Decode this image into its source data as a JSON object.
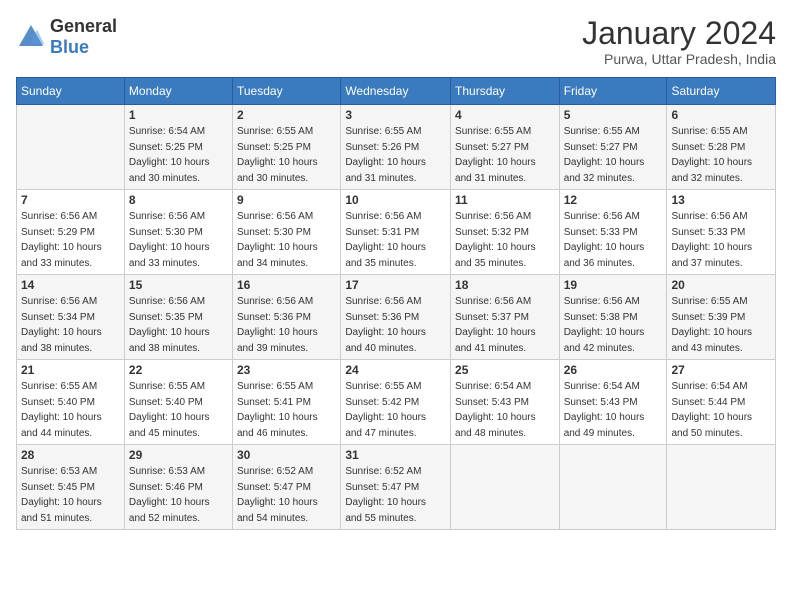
{
  "header": {
    "logo_general": "General",
    "logo_blue": "Blue",
    "month_year": "January 2024",
    "location": "Purwa, Uttar Pradesh, India"
  },
  "weekdays": [
    "Sunday",
    "Monday",
    "Tuesday",
    "Wednesday",
    "Thursday",
    "Friday",
    "Saturday"
  ],
  "weeks": [
    [
      {
        "day": "",
        "sunrise": "",
        "sunset": "",
        "daylight": ""
      },
      {
        "day": "1",
        "sunrise": "Sunrise: 6:54 AM",
        "sunset": "Sunset: 5:25 PM",
        "daylight": "Daylight: 10 hours and 30 minutes."
      },
      {
        "day": "2",
        "sunrise": "Sunrise: 6:55 AM",
        "sunset": "Sunset: 5:25 PM",
        "daylight": "Daylight: 10 hours and 30 minutes."
      },
      {
        "day": "3",
        "sunrise": "Sunrise: 6:55 AM",
        "sunset": "Sunset: 5:26 PM",
        "daylight": "Daylight: 10 hours and 31 minutes."
      },
      {
        "day": "4",
        "sunrise": "Sunrise: 6:55 AM",
        "sunset": "Sunset: 5:27 PM",
        "daylight": "Daylight: 10 hours and 31 minutes."
      },
      {
        "day": "5",
        "sunrise": "Sunrise: 6:55 AM",
        "sunset": "Sunset: 5:27 PM",
        "daylight": "Daylight: 10 hours and 32 minutes."
      },
      {
        "day": "6",
        "sunrise": "Sunrise: 6:55 AM",
        "sunset": "Sunset: 5:28 PM",
        "daylight": "Daylight: 10 hours and 32 minutes."
      }
    ],
    [
      {
        "day": "7",
        "sunrise": "Sunrise: 6:56 AM",
        "sunset": "Sunset: 5:29 PM",
        "daylight": "Daylight: 10 hours and 33 minutes."
      },
      {
        "day": "8",
        "sunrise": "Sunrise: 6:56 AM",
        "sunset": "Sunset: 5:30 PM",
        "daylight": "Daylight: 10 hours and 33 minutes."
      },
      {
        "day": "9",
        "sunrise": "Sunrise: 6:56 AM",
        "sunset": "Sunset: 5:30 PM",
        "daylight": "Daylight: 10 hours and 34 minutes."
      },
      {
        "day": "10",
        "sunrise": "Sunrise: 6:56 AM",
        "sunset": "Sunset: 5:31 PM",
        "daylight": "Daylight: 10 hours and 35 minutes."
      },
      {
        "day": "11",
        "sunrise": "Sunrise: 6:56 AM",
        "sunset": "Sunset: 5:32 PM",
        "daylight": "Daylight: 10 hours and 35 minutes."
      },
      {
        "day": "12",
        "sunrise": "Sunrise: 6:56 AM",
        "sunset": "Sunset: 5:33 PM",
        "daylight": "Daylight: 10 hours and 36 minutes."
      },
      {
        "day": "13",
        "sunrise": "Sunrise: 6:56 AM",
        "sunset": "Sunset: 5:33 PM",
        "daylight": "Daylight: 10 hours and 37 minutes."
      }
    ],
    [
      {
        "day": "14",
        "sunrise": "Sunrise: 6:56 AM",
        "sunset": "Sunset: 5:34 PM",
        "daylight": "Daylight: 10 hours and 38 minutes."
      },
      {
        "day": "15",
        "sunrise": "Sunrise: 6:56 AM",
        "sunset": "Sunset: 5:35 PM",
        "daylight": "Daylight: 10 hours and 38 minutes."
      },
      {
        "day": "16",
        "sunrise": "Sunrise: 6:56 AM",
        "sunset": "Sunset: 5:36 PM",
        "daylight": "Daylight: 10 hours and 39 minutes."
      },
      {
        "day": "17",
        "sunrise": "Sunrise: 6:56 AM",
        "sunset": "Sunset: 5:36 PM",
        "daylight": "Daylight: 10 hours and 40 minutes."
      },
      {
        "day": "18",
        "sunrise": "Sunrise: 6:56 AM",
        "sunset": "Sunset: 5:37 PM",
        "daylight": "Daylight: 10 hours and 41 minutes."
      },
      {
        "day": "19",
        "sunrise": "Sunrise: 6:56 AM",
        "sunset": "Sunset: 5:38 PM",
        "daylight": "Daylight: 10 hours and 42 minutes."
      },
      {
        "day": "20",
        "sunrise": "Sunrise: 6:55 AM",
        "sunset": "Sunset: 5:39 PM",
        "daylight": "Daylight: 10 hours and 43 minutes."
      }
    ],
    [
      {
        "day": "21",
        "sunrise": "Sunrise: 6:55 AM",
        "sunset": "Sunset: 5:40 PM",
        "daylight": "Daylight: 10 hours and 44 minutes."
      },
      {
        "day": "22",
        "sunrise": "Sunrise: 6:55 AM",
        "sunset": "Sunset: 5:40 PM",
        "daylight": "Daylight: 10 hours and 45 minutes."
      },
      {
        "day": "23",
        "sunrise": "Sunrise: 6:55 AM",
        "sunset": "Sunset: 5:41 PM",
        "daylight": "Daylight: 10 hours and 46 minutes."
      },
      {
        "day": "24",
        "sunrise": "Sunrise: 6:55 AM",
        "sunset": "Sunset: 5:42 PM",
        "daylight": "Daylight: 10 hours and 47 minutes."
      },
      {
        "day": "25",
        "sunrise": "Sunrise: 6:54 AM",
        "sunset": "Sunset: 5:43 PM",
        "daylight": "Daylight: 10 hours and 48 minutes."
      },
      {
        "day": "26",
        "sunrise": "Sunrise: 6:54 AM",
        "sunset": "Sunset: 5:43 PM",
        "daylight": "Daylight: 10 hours and 49 minutes."
      },
      {
        "day": "27",
        "sunrise": "Sunrise: 6:54 AM",
        "sunset": "Sunset: 5:44 PM",
        "daylight": "Daylight: 10 hours and 50 minutes."
      }
    ],
    [
      {
        "day": "28",
        "sunrise": "Sunrise: 6:53 AM",
        "sunset": "Sunset: 5:45 PM",
        "daylight": "Daylight: 10 hours and 51 minutes."
      },
      {
        "day": "29",
        "sunrise": "Sunrise: 6:53 AM",
        "sunset": "Sunset: 5:46 PM",
        "daylight": "Daylight: 10 hours and 52 minutes."
      },
      {
        "day": "30",
        "sunrise": "Sunrise: 6:52 AM",
        "sunset": "Sunset: 5:47 PM",
        "daylight": "Daylight: 10 hours and 54 minutes."
      },
      {
        "day": "31",
        "sunrise": "Sunrise: 6:52 AM",
        "sunset": "Sunset: 5:47 PM",
        "daylight": "Daylight: 10 hours and 55 minutes."
      },
      {
        "day": "",
        "sunrise": "",
        "sunset": "",
        "daylight": ""
      },
      {
        "day": "",
        "sunrise": "",
        "sunset": "",
        "daylight": ""
      },
      {
        "day": "",
        "sunrise": "",
        "sunset": "",
        "daylight": ""
      }
    ]
  ]
}
